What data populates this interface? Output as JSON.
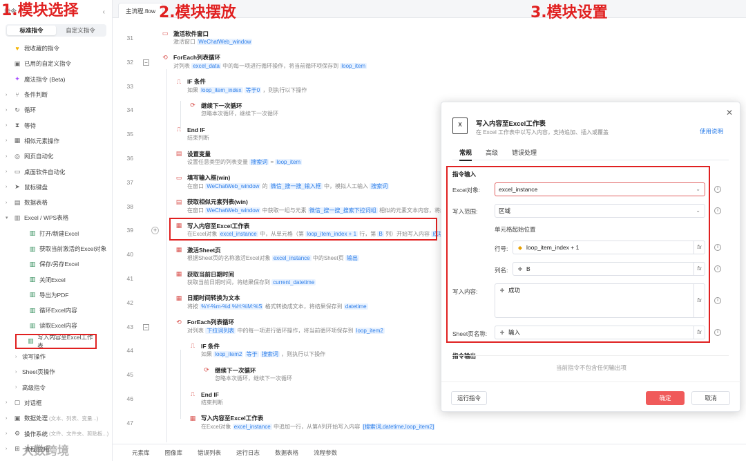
{
  "annotations": {
    "step1": "1.模块选择",
    "step2": "2.模块摆放",
    "step3": "3.模块设置"
  },
  "sidebar": {
    "header": "指令",
    "tabs": [
      "标准指令",
      "自定义指令"
    ],
    "items": [
      {
        "label": "我收藏的指令",
        "icon": "heart-icon"
      },
      {
        "label": "已用的自定义指令",
        "icon": "box-icon"
      },
      {
        "label": "魔法指令 (Beta)",
        "icon": "sparkle-icon"
      },
      {
        "label": "条件判断",
        "icon": "branch-icon"
      },
      {
        "label": "循环",
        "icon": "loop-icon"
      },
      {
        "label": "等待",
        "icon": "hourglass-icon"
      },
      {
        "label": "相似元素操作",
        "icon": "similar-icon"
      },
      {
        "label": "网页自动化",
        "icon": "globe-icon"
      },
      {
        "label": "桌面软件自动化",
        "icon": "monitor-icon"
      },
      {
        "label": "鼠标键盘",
        "icon": "cursor-icon"
      },
      {
        "label": "数据表格",
        "icon": "table-icon"
      },
      {
        "label": "Excel / WPS表格",
        "icon": "excel-icon"
      }
    ],
    "excel_children": [
      "打开/新建Excel",
      "获取当前激活的Excel对象",
      "保存/另存Excel",
      "关闭Excel",
      "导出为PDF",
      "循环Excel内容",
      "读取Excel内容",
      "写入内容至Excel工作表"
    ],
    "excel_groups": [
      "读写操作",
      "Sheet页操作",
      "高级指令"
    ],
    "bottom_items": [
      {
        "label": "对话框",
        "icon": "dialog-icon"
      },
      {
        "label": "数据处理",
        "hint": "(文本、列表、变量...)",
        "icon": "data-icon"
      },
      {
        "label": "操作系统",
        "hint": "(文件、文件夹、剪贴板...)",
        "icon": "os-icon"
      },
      {
        "label": "流程/应用",
        "icon": "flow-icon"
      }
    ]
  },
  "editor": {
    "tab_label": "主流程.flow",
    "rows": [
      {
        "ln": "31",
        "title": "激活软件窗口",
        "desc": [
          "激活窗口",
          {
            "chip": "WeChatWeb_window"
          }
        ]
      },
      {
        "ln": "32",
        "title": "ForEach列表循环",
        "desc": [
          "对列表",
          {
            "chip": "excel_data"
          },
          "中的每一项进行循环操作，将当前循环项保存到",
          {
            "chip": "loop_item"
          }
        ]
      },
      {
        "ln": "33",
        "title": "IF 条件",
        "desc": [
          "如果",
          {
            "chip": "loop_item_index"
          },
          {
            "chip": "等于0"
          },
          "，则执行以下操作"
        ]
      },
      {
        "ln": "34",
        "title": "继续下一次循环",
        "desc": [
          "忽略本次循环，继续下一次循环"
        ]
      },
      {
        "ln": "35",
        "title": "End IF",
        "desc": [
          "结束判断"
        ]
      },
      {
        "ln": "36",
        "title": "设置变量",
        "desc": [
          "设置任意类型的列表变量",
          {
            "chip": "搜索词"
          },
          "=",
          {
            "chip": "loop_item"
          }
        ]
      },
      {
        "ln": "37",
        "title": "填写输入框(win)",
        "desc": [
          "在窗口",
          {
            "chip": "WeChatWeb_window"
          },
          "的",
          {
            "chip": "微信_搜一搜_输入框"
          },
          "中，模拟人工输入",
          {
            "chip": "搜索词"
          }
        ]
      },
      {
        "ln": "38",
        "title": "获取相似元素列表(win)",
        "desc": [
          "在窗口",
          {
            "chip": "WeChatWeb_window"
          },
          "中获取一组与元素",
          {
            "chip": "微信_搜一搜_搜索下拉词组"
          },
          "相似的元素文本内容，将结果保存"
        ]
      },
      {
        "ln": "39",
        "title": "写入内容至Excel工作表",
        "desc": [
          "在Excel对象",
          {
            "chip": "excel_instance"
          },
          "中，从单元格（第",
          {
            "chip": "loop_item_index + 1"
          },
          "行，第",
          {
            "chip": "B"
          },
          "列）开始写入内容",
          {
            "chip": "成功"
          }
        ]
      },
      {
        "ln": "40",
        "title": "激活Sheet页",
        "desc": [
          "根据Sheet页的名称激活Excel对象",
          {
            "chip": "excel_instance"
          },
          "中的Sheet页",
          {
            "chip": "输出"
          }
        ]
      },
      {
        "ln": "41",
        "title": "获取当前日期时间",
        "desc": [
          "获取当前日期时间，将结果保存到",
          {
            "chip": "current_datetime"
          }
        ]
      },
      {
        "ln": "42",
        "title": "日期时间转换为文本",
        "desc": [
          "将按",
          {
            "chip": "%Y-%m-%d %H:%M:%S"
          },
          "格式转换成文本，将结果保存到",
          {
            "chip": "datetime"
          }
        ]
      },
      {
        "ln": "43",
        "title": "ForEach列表循环",
        "desc": [
          "对列表",
          {
            "chip": "下拉词列表"
          },
          "中的每一项进行循环操作，将当前循环项保存到",
          {
            "chip": "loop_item2"
          }
        ]
      },
      {
        "ln": "44",
        "title": "IF 条件",
        "desc": [
          "如果",
          {
            "chip": "loop_item2"
          },
          {
            "chip": "等于"
          },
          {
            "chip": "搜索词"
          },
          "，则执行以下操作"
        ]
      },
      {
        "ln": "45",
        "title": "继续下一次循环",
        "desc": [
          "忽略本次循环，继续下一次循环"
        ]
      },
      {
        "ln": "46",
        "title": "End IF",
        "desc": [
          "结束判断"
        ]
      },
      {
        "ln": "47",
        "title": "写入内容至Excel工作表",
        "desc": [
          "在Excel对象",
          {
            "chip": "excel_instance"
          },
          "中追加一行，从第A列开始写入内容",
          {
            "chip": "[搜索词,datetime,loop_item2]"
          }
        ]
      }
    ]
  },
  "bottom_tabs": [
    "元素库",
    "图像库",
    "错误列表",
    "运行日志",
    "数据表格",
    "流程参数"
  ],
  "watermark": "大数跨境",
  "dialog": {
    "title": "写入内容至Excel工作表",
    "subtitle": "在 Excel 工作表中以写入内容，支持追加、插入或覆盖",
    "help": "使用说明",
    "tabs": [
      "常规",
      "高级",
      "错误处理"
    ],
    "input_section": "指令输入",
    "fields": {
      "excel_label": "Excel对象:",
      "excel_value": "excel_instance",
      "range_label": "写入范围:",
      "range_value": "区域",
      "cell_start": "单元格起始位置",
      "row_label": "行号:",
      "row_value": "loop_item_index + 1",
      "col_label": "列名:",
      "col_value": "B",
      "content_label": "写入内容:",
      "content_value": "成功",
      "sheet_label": "Sheet页名称:",
      "sheet_value": "输入",
      "fx": "fx"
    },
    "output_section": "指令输出",
    "output_empty": "当前指令不包含任何输出项",
    "run_button": "运行指令",
    "ok_button": "确定",
    "cancel_button": "取消"
  }
}
